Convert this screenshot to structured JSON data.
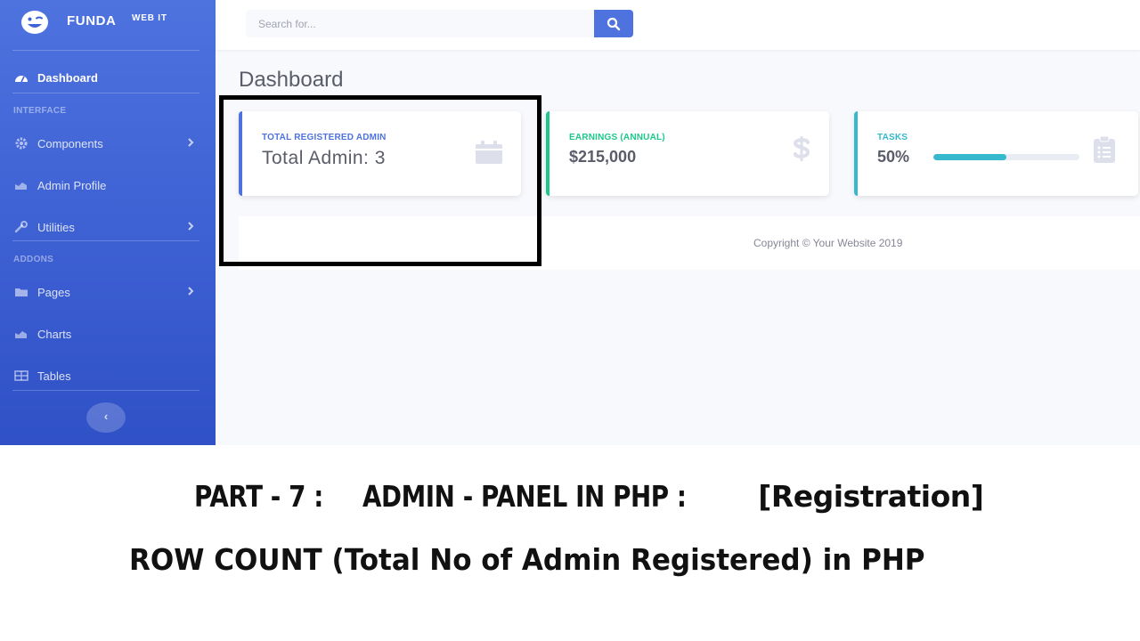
{
  "brand": {
    "name": "FUNDA",
    "suffix": "WEB IT",
    "logo_icon": "smiley-face-icon"
  },
  "sidebar": {
    "dashboard": "Dashboard",
    "section_interface": "INTERFACE",
    "section_addons": "ADDONS",
    "items": [
      {
        "label": "Components",
        "icon": "gear-icon",
        "has_chevron": true
      },
      {
        "label": "Admin Profile",
        "icon": "chart-area-icon",
        "has_chevron": false
      },
      {
        "label": "Utilities",
        "icon": "wrench-icon",
        "has_chevron": true
      },
      {
        "label": "Pages",
        "icon": "folder-icon",
        "has_chevron": true
      },
      {
        "label": "Charts",
        "icon": "chart-area-icon",
        "has_chevron": false
      },
      {
        "label": "Tables",
        "icon": "table-icon",
        "has_chevron": false
      }
    ],
    "toggle_glyph": "‹"
  },
  "search": {
    "placeholder": "Search for..."
  },
  "page": {
    "title": "Dashboard"
  },
  "cards": [
    {
      "caption": "TOTAL REGISTERED ADMIN",
      "value": "Total Admin: 3",
      "accent": "#4e73df",
      "icon": "calendar-icon"
    },
    {
      "caption": "EARNINGS (ANNUAL)",
      "value": "$215,000",
      "accent": "#1cc88a",
      "icon": "dollar-icon"
    },
    {
      "caption": "TASKS",
      "value": "50%",
      "accent": "#36b9cc",
      "icon": "clipboard-list-icon",
      "progress": 0.5
    }
  ],
  "footer": {
    "text": "Copyright © Your Website 2019"
  },
  "captions": {
    "line1_part": "PART - 7 :",
    "line1_title": "ADMIN - PANEL IN PHP :",
    "line1_tag": "[Registration]",
    "line2": "ROW COUNT (Total No of Admin Registered) in PHP"
  },
  "colors": {
    "primary": "#4e73df",
    "success": "#1cc88a",
    "info": "#36b9cc",
    "text": "#5a5c69",
    "background": "#f8f9fc"
  }
}
